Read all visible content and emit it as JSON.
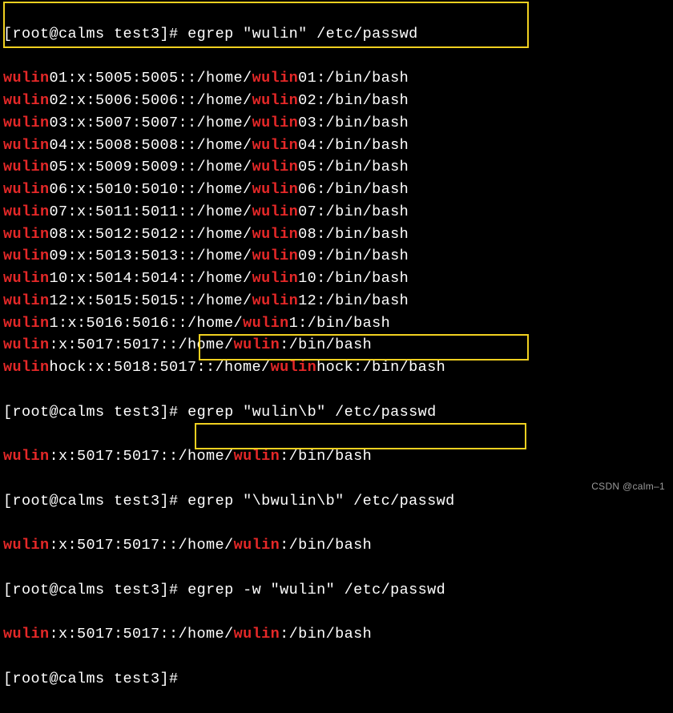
{
  "prompt": {
    "user": "root",
    "host": "calms",
    "dir": "test3",
    "open": "[root@calms test3]#"
  },
  "commands": {
    "c1": "egrep \"wulin\" /etc/passwd",
    "c2": "egrep \"wulin\\b\" /etc/passwd",
    "c3": "egrep \"\\bwulin\\b\" /etc/passwd",
    "c4": "egrep -w \"wulin\" /etc/passwd"
  },
  "match": "wulin",
  "rows": [
    {
      "p": "",
      "u": "wulin",
      "n": "01",
      "uid": "5005",
      "gid": "5005",
      "h": "01"
    },
    {
      "p": "",
      "u": "wulin",
      "n": "02",
      "uid": "5006",
      "gid": "5006",
      "h": "02"
    },
    {
      "p": "",
      "u": "wulin",
      "n": "03",
      "uid": "5007",
      "gid": "5007",
      "h": "03"
    },
    {
      "p": "",
      "u": "wulin",
      "n": "04",
      "uid": "5008",
      "gid": "5008",
      "h": "04"
    },
    {
      "p": "",
      "u": "wulin",
      "n": "05",
      "uid": "5009",
      "gid": "5009",
      "h": "05"
    },
    {
      "p": "",
      "u": "wulin",
      "n": "06",
      "uid": "5010",
      "gid": "5010",
      "h": "06"
    },
    {
      "p": "",
      "u": "wulin",
      "n": "07",
      "uid": "5011",
      "gid": "5011",
      "h": "07"
    },
    {
      "p": "",
      "u": "wulin",
      "n": "08",
      "uid": "5012",
      "gid": "5012",
      "h": "08"
    },
    {
      "p": "",
      "u": "wulin",
      "n": "09",
      "uid": "5013",
      "gid": "5013",
      "h": "09"
    },
    {
      "p": "",
      "u": "wulin",
      "n": "10",
      "uid": "5014",
      "gid": "5014",
      "h": "10"
    },
    {
      "p": "",
      "u": "wulin",
      "n": "12",
      "uid": "5015",
      "gid": "5015",
      "h": "12"
    },
    {
      "p": "",
      "u": "wulin",
      "n": "1",
      "uid": "5016",
      "gid": "5016",
      "h": "1"
    },
    {
      "p": "",
      "u": "wulin",
      "n": "",
      "uid": "5017",
      "gid": "5017",
      "h": ""
    },
    {
      "p": "",
      "u": "wulin",
      "n": "hock",
      "uid": "5018",
      "gid": "5017",
      "h": "hock"
    }
  ],
  "single": {
    "u": "wulin",
    "n": "",
    "uid": "5017",
    "gid": "5017",
    "h": ""
  },
  "watermark": "CSDN @calm–1",
  "sep": {
    "colon": ":",
    "x": "x",
    "homepre": "/home/",
    "shell": "/bin/bash"
  }
}
